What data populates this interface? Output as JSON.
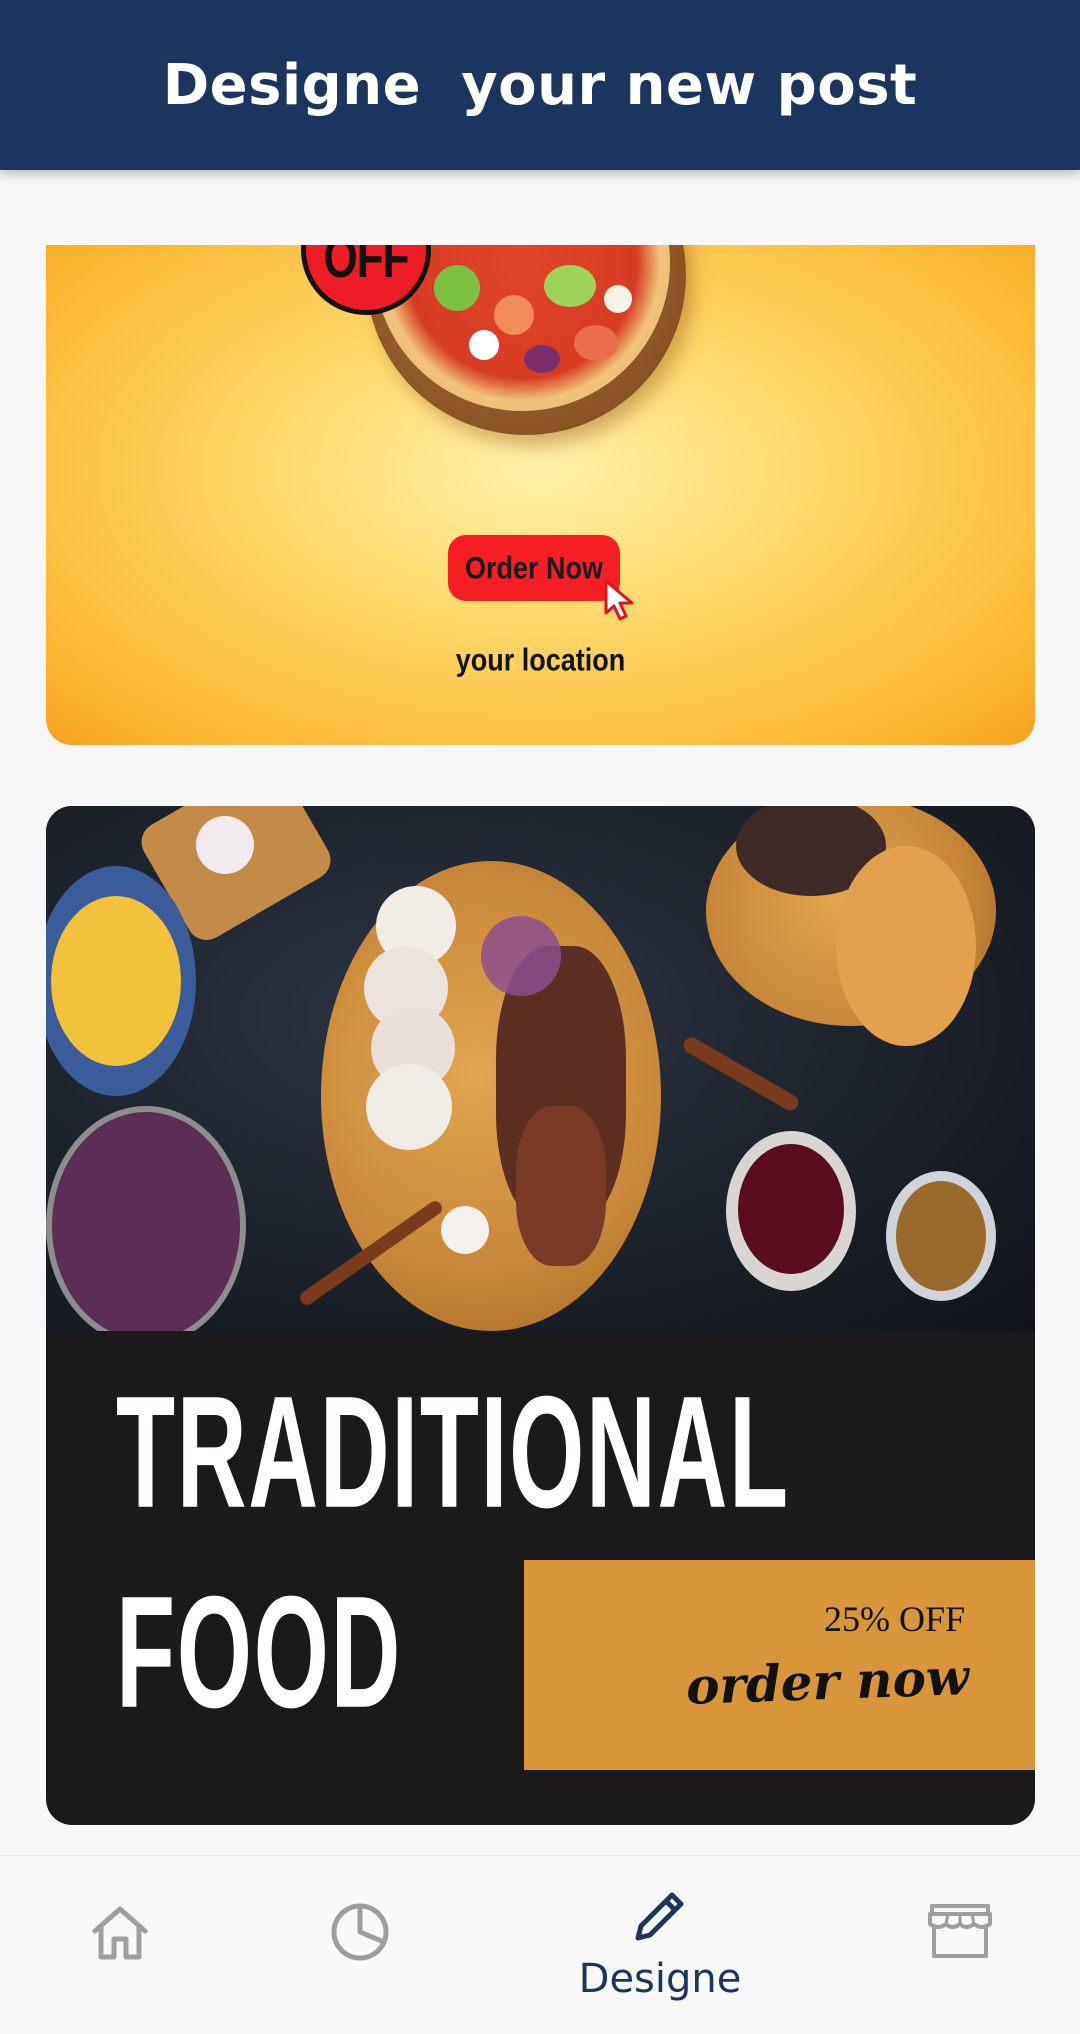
{
  "header": {
    "title": "Designe  your new post"
  },
  "posts": [
    {
      "badge": "OFF",
      "button_label": "Order Now",
      "location": "your location"
    },
    {
      "title_line1": "TRADITIONAL",
      "title_line2": "FOOD",
      "discount": "25% OFF",
      "cta": "order now"
    }
  ],
  "bottom_nav": {
    "items": [
      {
        "icon": "home-icon",
        "label": ""
      },
      {
        "icon": "pie-chart-icon",
        "label": ""
      },
      {
        "icon": "pencil-icon",
        "label": "Designe",
        "active": true
      },
      {
        "icon": "store-icon",
        "label": ""
      }
    ]
  },
  "colors": {
    "header_bg": "#1c355e",
    "accent": "#1c355e",
    "inactive_icon": "#9e9e9e",
    "promo_box": "#d9953a",
    "order_button": "#f51e23"
  }
}
